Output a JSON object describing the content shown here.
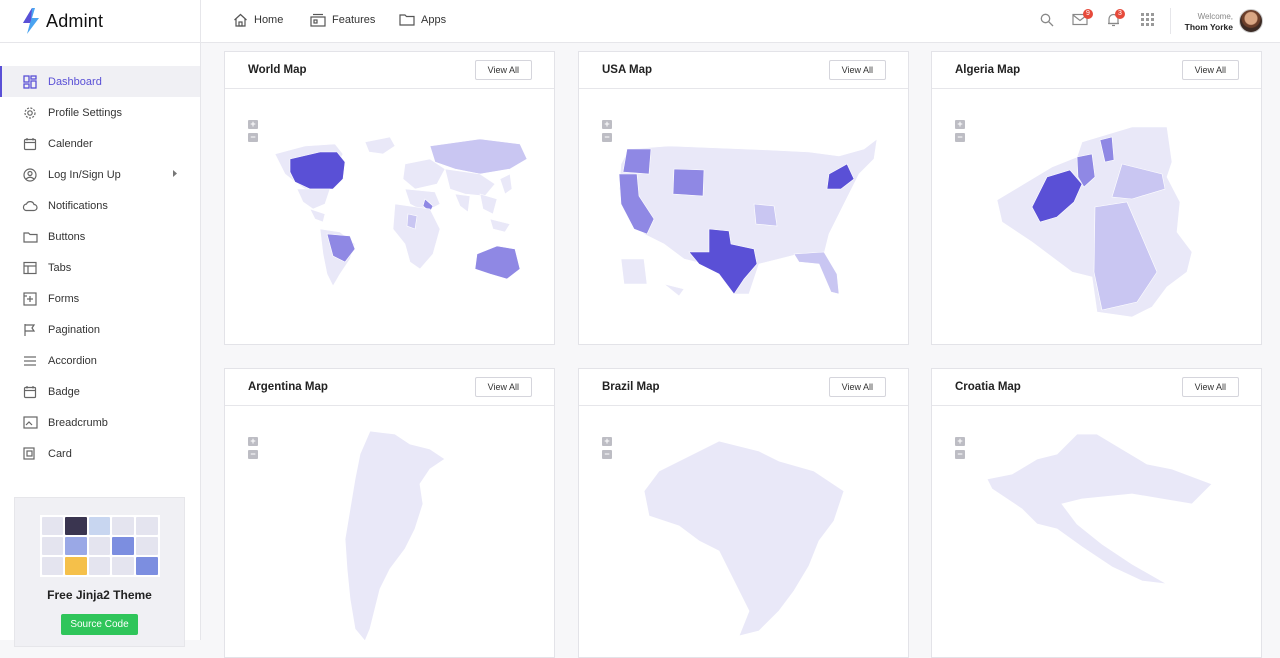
{
  "brand": {
    "name": "Admint"
  },
  "sidebar": {
    "items": [
      {
        "label": "Dashboard",
        "icon": "dashboard-icon"
      },
      {
        "label": "Profile Settings",
        "icon": "gear-icon"
      },
      {
        "label": "Calender",
        "icon": "calendar-icon"
      },
      {
        "label": "Log In/Sign Up",
        "icon": "user-circle-icon"
      },
      {
        "label": "Notifications",
        "icon": "cloud-icon"
      },
      {
        "label": "Buttons",
        "icon": "folder-icon"
      },
      {
        "label": "Tabs",
        "icon": "layout-icon"
      },
      {
        "label": "Forms",
        "icon": "form-icon"
      },
      {
        "label": "Pagination",
        "icon": "flag-icon"
      },
      {
        "label": "Accordion",
        "icon": "menu-lines-icon"
      },
      {
        "label": "Badge",
        "icon": "calendar-icon"
      },
      {
        "label": "Breadcrumb",
        "icon": "image-icon"
      },
      {
        "label": "Card",
        "icon": "copy-icon"
      }
    ],
    "promo": {
      "title": "Free Jinja2 Theme",
      "button": "Source Code"
    }
  },
  "topbar": {
    "nav": [
      {
        "label": "Home",
        "icon": "home-icon"
      },
      {
        "label": "Features",
        "icon": "features-icon"
      },
      {
        "label": "Apps",
        "icon": "folder-icon"
      }
    ],
    "mail_badge": "9",
    "bell_badge": "3",
    "welcome": "Welcome,",
    "user": "Thom Yorke"
  },
  "cards": [
    {
      "title": "World Map",
      "button": "View All"
    },
    {
      "title": "USA Map",
      "button": "View All"
    },
    {
      "title": "Algeria Map",
      "button": "View All"
    },
    {
      "title": "Argentina Map",
      "button": "View All"
    },
    {
      "title": "Brazil Map",
      "button": "View All"
    },
    {
      "title": "Croatia Map",
      "button": "View All"
    }
  ],
  "zoom": {
    "in": "+",
    "out": "−"
  },
  "colors": {
    "accent": "#5a50d6",
    "mid": "#8f88e4",
    "light": "#c9c6f2",
    "base": "#e9e8f8",
    "green": "#2fc55a"
  }
}
